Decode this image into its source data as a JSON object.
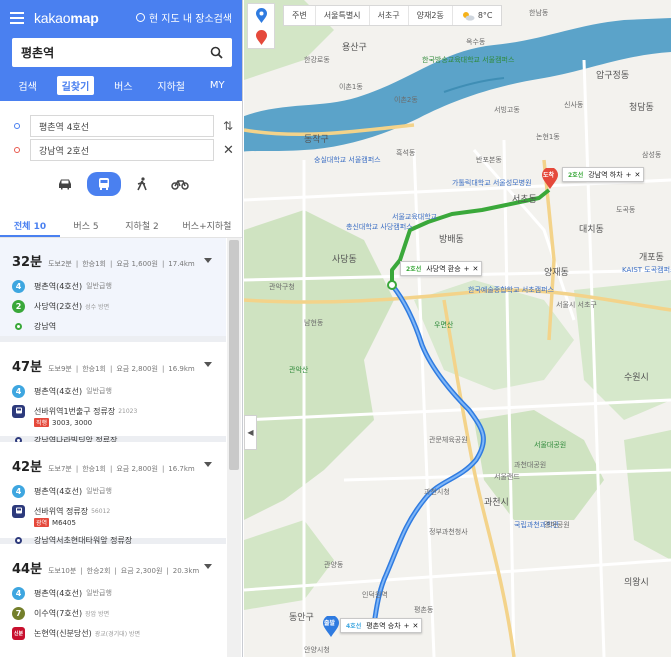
{
  "brand": {
    "logo_a": "kakao",
    "logo_b": "map",
    "nearby_label": "현 지도 내 장소검색"
  },
  "search": {
    "value": "평촌역"
  },
  "tabs": [
    {
      "label": "검색",
      "active": false
    },
    {
      "label": "길찾기",
      "active": true
    },
    {
      "label": "버스",
      "active": false
    },
    {
      "label": "지하철",
      "active": false
    },
    {
      "label": "MY",
      "active": false
    }
  ],
  "route": {
    "origin": "평촌역 4호선",
    "destination": "강남역 2호선"
  },
  "modes": [
    "car-icon",
    "bus-icon",
    "walk-icon",
    "bike-icon"
  ],
  "subtabs": [
    {
      "label": "전체 10",
      "active": true
    },
    {
      "label": "버스 5",
      "active": false
    },
    {
      "label": "지하철 2",
      "active": false
    },
    {
      "label": "버스+지하철",
      "active": false
    }
  ],
  "colors": {
    "primary": "#4a80f0",
    "line4": "#3ea6e0",
    "line2": "#3aa83a",
    "line7": "#747f2b",
    "bus": "#2d3a7c",
    "red": "#e5493b"
  },
  "results": [
    {
      "time": "32분",
      "meta": [
        "도보2분",
        "한승1회",
        "요금 1,600원",
        "17.4km"
      ],
      "steps": [
        {
          "badge": "4",
          "color": "#3ea6e0",
          "name": "평촌역(4호선)",
          "sub": "일반급행"
        },
        {
          "badge": "2",
          "color": "#3aa83a",
          "name": "사당역(2호선)",
          "sub": "성수 방면"
        },
        {
          "badge": "",
          "color": "#3aa83a",
          "name": "강남역",
          "sub": ""
        }
      ]
    },
    {
      "time": "47분",
      "meta": [
        "도보9분",
        "한승1회",
        "요금 2,800원",
        "16.9km"
      ],
      "steps": [
        {
          "badge": "4",
          "color": "#3ea6e0",
          "name": "평촌역(4호선)",
          "sub": "일반급행"
        },
        {
          "badge": "bus",
          "color": "#2d3a7c",
          "name": "선바위역1번출구 정류장",
          "sub": "21023",
          "bus_tag": "직행",
          "bus_nums": "3003, 3000"
        },
        {
          "badge": "",
          "color": "#2d3a7c",
          "name": "강남역나라빌딩앞 정류장",
          "sub": ""
        }
      ]
    },
    {
      "time": "42분",
      "meta": [
        "도보7분",
        "한승1회",
        "요금 2,800원",
        "16.7km"
      ],
      "steps": [
        {
          "badge": "4",
          "color": "#3ea6e0",
          "name": "평촌역(4호선)",
          "sub": "일반급행"
        },
        {
          "badge": "bus",
          "color": "#2d3a7c",
          "name": "선바위역 정류장",
          "sub": "56012",
          "bus_tag": "광역",
          "bus_nums": "M6405"
        },
        {
          "badge": "",
          "color": "#2d3a7c",
          "name": "강남역서초현대타워앞 정류장",
          "sub": ""
        }
      ]
    },
    {
      "time": "44분",
      "meta": [
        "도보10분",
        "한승2회",
        "요금 2,300원",
        "20.3km"
      ],
      "steps": [
        {
          "badge": "4",
          "color": "#3ea6e0",
          "name": "평촌역(4호선)",
          "sub": "일반급행"
        },
        {
          "badge": "7",
          "color": "#747f2b",
          "name": "이수역(7호선)",
          "sub": "장암 방면"
        },
        {
          "badge": "신분",
          "color": "#c8102e",
          "name": "논현역(신분당선)",
          "sub": "광교(경기대) 방면"
        }
      ]
    }
  ],
  "map": {
    "topbar": [
      "주변",
      "서울특별시",
      "서초구",
      "양재2동",
      "8°C"
    ],
    "bubbles": [
      {
        "line": "2호선",
        "name": "강남역 하차",
        "color": "#3aa83a"
      },
      {
        "line": "2호선",
        "name": "사당역 환승",
        "color": "#3aa83a"
      },
      {
        "line": "4호선",
        "name": "평촌역 승차",
        "color": "#3ea6e0"
      }
    ],
    "pins": {
      "arrive": "도착",
      "depart": "출발"
    },
    "labels": [
      "용산구",
      "한강로동",
      "한국방송교육대학교 서울캠퍼스",
      "옥수동",
      "이촌1동",
      "한남동",
      "이촌2동",
      "압구정동",
      "신사동",
      "논현1동",
      "청담동",
      "삼성동",
      "서빙고동",
      "동작구",
      "흑석동",
      "반포본동",
      "숭실대학교 서울캠퍼스",
      "서초동",
      "대치동",
      "총신대학교 사당캠퍼스",
      "서울교육대학교",
      "가톨릭대학교 서울성모병원",
      "양재동",
      "도곡동",
      "개포동",
      "사당동",
      "방배동",
      "관악구청",
      "관악산",
      "과천시",
      "과천시청",
      "한국예술종합학교 서초캠퍼스",
      "우면산",
      "서울대공원",
      "서울랜드",
      "과천대공원",
      "의왕시",
      "안양시청",
      "동안구",
      "평촌동",
      "관양동",
      "남현동",
      "서울시 서초구",
      "KAIST 도곡캠퍼스",
      "국립과천과학관",
      "수원시",
      "인덕원역",
      "정부과천청사",
      "관문체육공원",
      "경마공원"
    ]
  }
}
